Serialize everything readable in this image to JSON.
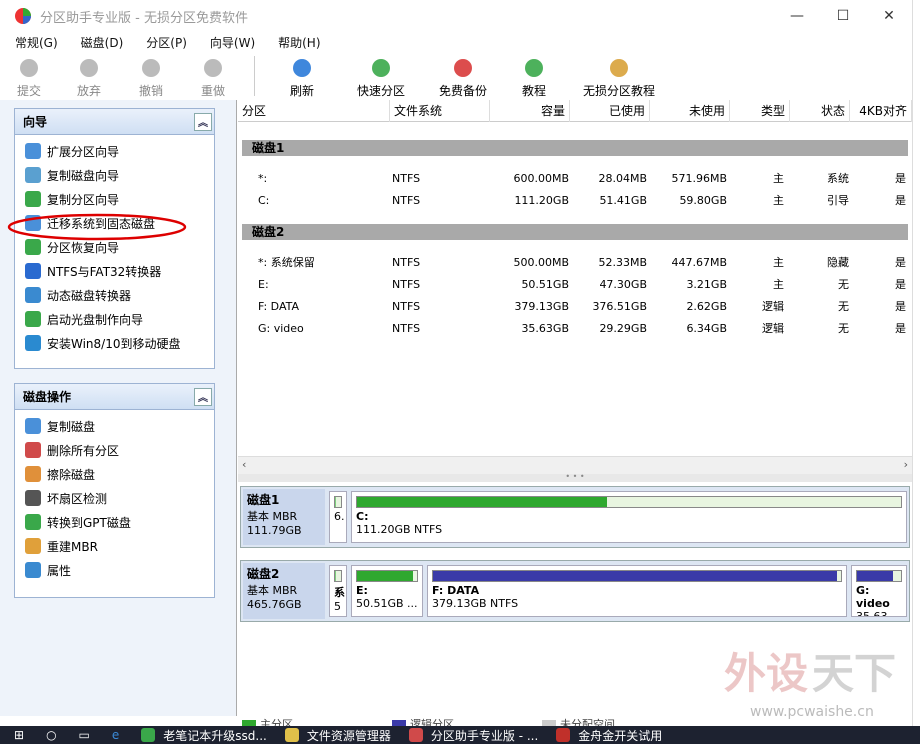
{
  "window": {
    "title": "分区助手专业版 - 无损分区免费软件",
    "min": "—",
    "max": "☐",
    "close": "✕"
  },
  "menu": [
    "常规(G)",
    "磁盘(D)",
    "分区(P)",
    "向导(W)",
    "帮助(H)"
  ],
  "toolbar": [
    {
      "label": "提交",
      "icon": "check-icon",
      "enabled": false
    },
    {
      "label": "放弃",
      "icon": "discard-icon",
      "enabled": false
    },
    {
      "label": "撤销",
      "icon": "undo-icon",
      "enabled": false
    },
    {
      "label": "重做",
      "icon": "redo-icon",
      "enabled": false
    },
    {
      "label": "刷新",
      "icon": "refresh-icon",
      "enabled": true
    },
    {
      "label": "快速分区",
      "icon": "quick-partition-icon",
      "enabled": true
    },
    {
      "label": "免费备份",
      "icon": "backup-icon",
      "enabled": true
    },
    {
      "label": "教程",
      "icon": "tutorial-icon",
      "enabled": true
    },
    {
      "label": "无损分区教程",
      "icon": "tutorial-video-icon",
      "enabled": true
    }
  ],
  "wizard_panel": {
    "title": "向导",
    "items": [
      "扩展分区向导",
      "复制磁盘向导",
      "复制分区向导",
      "迁移系统到固态磁盘",
      "分区恢复向导",
      "NTFS与FAT32转换器",
      "动态磁盘转换器",
      "启动光盘制作向导",
      "安装Win8/10到移动硬盘"
    ]
  },
  "disk_ops_panel": {
    "title": "磁盘操作",
    "items": [
      "复制磁盘",
      "删除所有分区",
      "擦除磁盘",
      "坏扇区检测",
      "转换到GPT磁盘",
      "重建MBR",
      "属性"
    ]
  },
  "table": {
    "columns": [
      "分区",
      "文件系统",
      "容量",
      "已使用",
      "未使用",
      "类型",
      "状态",
      "4KB对齐"
    ],
    "disks": [
      {
        "name": "磁盘1",
        "rows": [
          [
            "*:",
            "NTFS",
            "600.00MB",
            "28.04MB",
            "571.96MB",
            "主",
            "系统",
            "是"
          ],
          [
            "C:",
            "NTFS",
            "111.20GB",
            "51.41GB",
            "59.80GB",
            "主",
            "引导",
            "是"
          ]
        ]
      },
      {
        "name": "磁盘2",
        "rows": [
          [
            "*: 系统保留",
            "NTFS",
            "500.00MB",
            "52.33MB",
            "447.67MB",
            "主",
            "隐藏",
            "是"
          ],
          [
            "E:",
            "NTFS",
            "50.51GB",
            "47.30GB",
            "3.21GB",
            "主",
            "无",
            "是"
          ],
          [
            "F: DATA",
            "NTFS",
            "379.13GB",
            "376.51GB",
            "2.62GB",
            "逻辑",
            "无",
            "是"
          ],
          [
            "G: video",
            "NTFS",
            "35.63GB",
            "29.29GB",
            "6.34GB",
            "逻辑",
            "无",
            "是"
          ]
        ]
      }
    ]
  },
  "diskmaps": [
    {
      "name": "磁盘1",
      "type": "基本 MBR",
      "size": "111.79GB",
      "parts": [
        {
          "label": "",
          "info": "6.",
          "fill": 0.05,
          "color": "#7ed07e"
        },
        {
          "label": "C:",
          "info": "111.20GB NTFS",
          "fill": 0.46,
          "color": "#2fa82f"
        }
      ]
    },
    {
      "name": "磁盘2",
      "type": "基本 MBR",
      "size": "465.76GB",
      "parts": [
        {
          "label": "系",
          "info": "5",
          "fill": 0.1,
          "color": "#7ed07e"
        },
        {
          "label": "E:",
          "info": "50.51GB ...",
          "fill": 0.94,
          "color": "#2fa82f"
        },
        {
          "label": "F: DATA",
          "info": "379.13GB NTFS",
          "fill": 0.99,
          "color": "#3a3aa8"
        },
        {
          "label": "G: video",
          "info": "35.63...",
          "fill": 0.82,
          "color": "#3a3aa8"
        }
      ]
    }
  ],
  "legend": [
    "主分区",
    "逻辑分区",
    "未分配空间"
  ],
  "taskbar": [
    "老笔记本升级ssd...",
    "文件资源管理器",
    "分区助手专业版 - ...",
    "金舟金开关试用"
  ],
  "watermark": {
    "text": "外设天下",
    "url": "www.pcwaishe.cn"
  }
}
